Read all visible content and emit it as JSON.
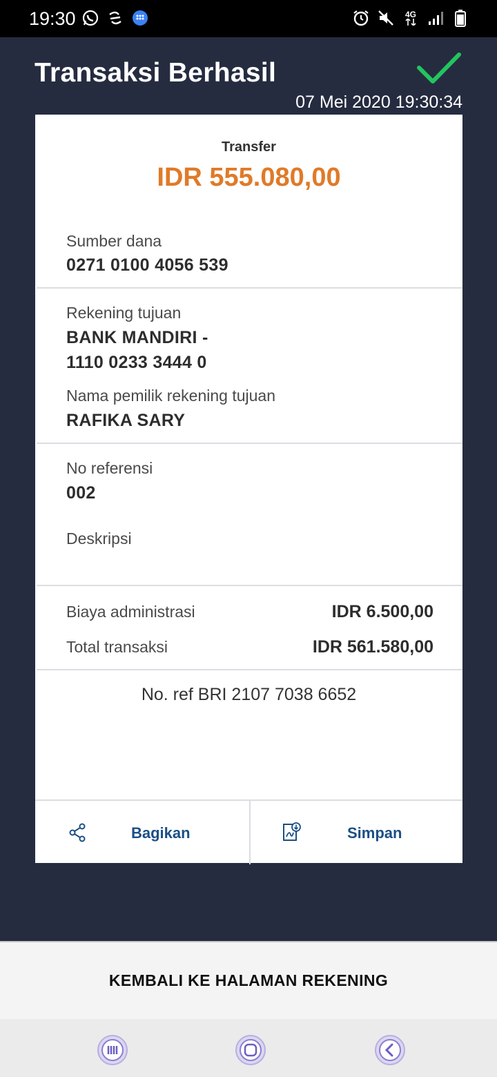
{
  "status_bar": {
    "time": "19:30",
    "network": "4G",
    "left_icons": [
      "whatsapp-icon",
      "fan-icon",
      "messenger-icon"
    ],
    "right_icons": [
      "alarm-icon",
      "mute-icon",
      "network-4g-icon",
      "signal-icon",
      "battery-icon"
    ]
  },
  "header": {
    "title": "Transaksi Berhasil",
    "datetime": "07 Mei 2020 19:30:34",
    "success_icon": "check-icon"
  },
  "receipt": {
    "type": "Transfer",
    "amount": "IDR 555.080,00",
    "source_label": "Sumber dana",
    "source_value": "0271 0100 4056 539",
    "dest_label": "Rekening tujuan",
    "dest_bank": "BANK MANDIRI -",
    "dest_account": "1110 0233 3444 0",
    "owner_label": "Nama pemilik rekening tujuan",
    "owner_value": "RAFIKA SARY",
    "ref_label": "No referensi",
    "ref_value": "002",
    "desc_label": "Deskripsi",
    "admin_label": "Biaya administrasi",
    "admin_value": "IDR 6.500,00",
    "total_label": "Total transaksi",
    "total_value": "IDR 561.580,00",
    "bri_ref": "No. ref BRI 2107 7038 6652"
  },
  "actions": {
    "share_label": "Bagikan",
    "save_label": "Simpan"
  },
  "footer": {
    "back_label": "KEMBALI KE HALAMAN REKENING"
  },
  "colors": {
    "background": "#262c40",
    "amount": "#e07a28",
    "accent": "#1b4f84",
    "success": "#22c55e"
  }
}
